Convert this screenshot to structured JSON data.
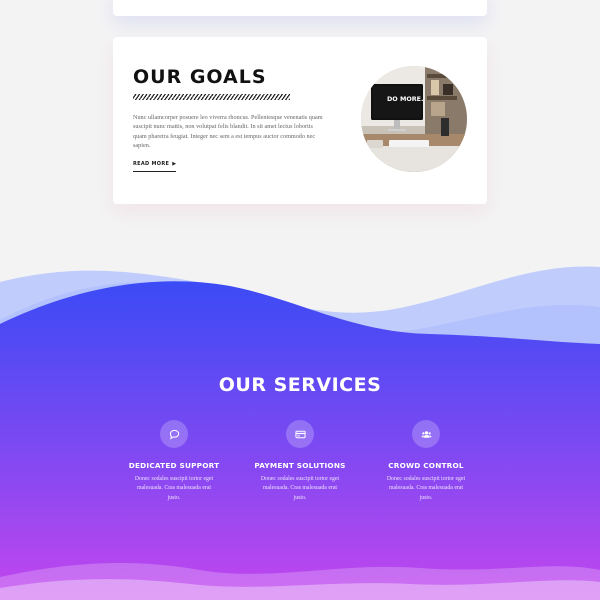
{
  "goals": {
    "title": "OUR GOALS",
    "body": "Nunc ullamcorper posuere leo viverra rhoncus. Pellentesque venenatis quam suscipit nunc mattis, non volutpat felis blandit. In sit amet lectus lobortis quam pharetra feugiat. Integer nec sem a est tempus auctor commodo nec sapien.",
    "read_more": "READ MORE",
    "photo_text": "DO MORE."
  },
  "services": {
    "title": "OUR SERVICES",
    "items": [
      {
        "title": "DEDICATED SUPPORT",
        "desc": "Donec sodales suscipit tortor eget malesuada. Cras malesuada erat justo.",
        "icon": "chat-icon"
      },
      {
        "title": "PAYMENT SOLUTIONS",
        "desc": "Donec sodales suscipit tortor eget malesuada. Cras malesuada erat justo.",
        "icon": "credit-card-icon"
      },
      {
        "title": "CROWD CONTROL",
        "desc": "Donec sodales suscipit tortor eget malesuada. Cras malesuada erat justo.",
        "icon": "users-icon"
      }
    ]
  },
  "colors": {
    "gradient_top": "#3b4bf5",
    "gradient_bottom": "#c446ee",
    "background": "#f3f3f4",
    "card": "#ffffff"
  }
}
